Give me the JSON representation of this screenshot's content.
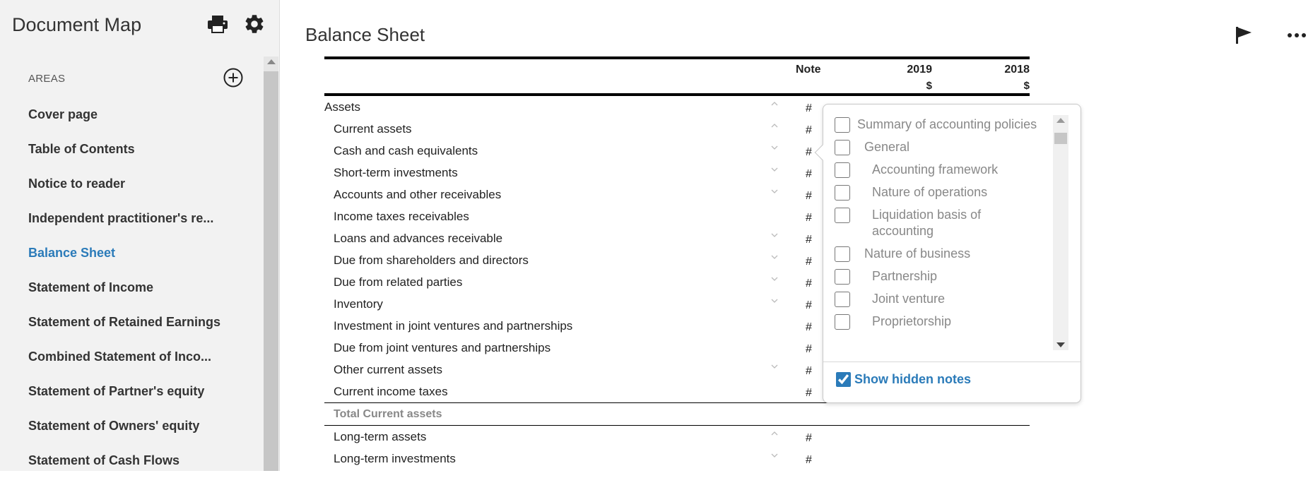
{
  "sidebar": {
    "title": "Document Map",
    "areas_label": "AREAS",
    "items": [
      {
        "label": "Cover page"
      },
      {
        "label": "Table of Contents"
      },
      {
        "label": "Notice to reader"
      },
      {
        "label": "Independent practitioner's re..."
      },
      {
        "label": "Balance Sheet"
      },
      {
        "label": "Statement of Income"
      },
      {
        "label": "Statement of Retained Earnings"
      },
      {
        "label": "Combined Statement of Inco..."
      },
      {
        "label": "Statement of Partner's equity"
      },
      {
        "label": "Statement of Owners' equity"
      },
      {
        "label": "Statement of Cash Flows"
      }
    ],
    "active_item": "Balance Sheet"
  },
  "main": {
    "title": "Balance Sheet",
    "table": {
      "note_header": "Note",
      "year1": "2019",
      "year2": "2018",
      "currency1": "$",
      "currency2": "$",
      "rows": [
        {
          "label": "Assets",
          "hash": "#",
          "chevron": "up"
        },
        {
          "label": "Current assets",
          "hash": "#",
          "chevron": "up"
        },
        {
          "label": "Cash and cash equivalents",
          "hash": "#",
          "chevron": "down"
        },
        {
          "label": "Short-term investments",
          "hash": "#",
          "chevron": "down"
        },
        {
          "label": "Accounts and other receivables",
          "hash": "#",
          "chevron": "down"
        },
        {
          "label": "Income taxes receivables",
          "hash": "#",
          "chevron": ""
        },
        {
          "label": "Loans and advances receivable",
          "hash": "#",
          "chevron": "down"
        },
        {
          "label": "Due from shareholders and directors",
          "hash": "#",
          "chevron": "down"
        },
        {
          "label": "Due from related parties",
          "hash": "#",
          "chevron": "down"
        },
        {
          "label": "Inventory",
          "hash": "#",
          "chevron": "down"
        },
        {
          "label": "Investment in joint ventures and partnerships",
          "hash": "#",
          "chevron": ""
        },
        {
          "label": "Due from joint ventures and partnerships",
          "hash": "#",
          "chevron": ""
        },
        {
          "label": "Other current assets",
          "hash": "#",
          "chevron": "down"
        },
        {
          "label": "Current income taxes",
          "hash": "#",
          "chevron": ""
        },
        {
          "label": "Total Current assets",
          "hash": "",
          "chevron": ""
        },
        {
          "label": "Long-term assets",
          "hash": "#",
          "chevron": "up"
        },
        {
          "label": "Long-term investments",
          "hash": "#",
          "chevron": "down"
        }
      ]
    }
  },
  "notes_popup": {
    "options": [
      {
        "label": "Summary of accounting policies",
        "checked": false
      },
      {
        "label": "General",
        "checked": false
      },
      {
        "label": "Accounting framework",
        "checked": false
      },
      {
        "label": "Nature of operations",
        "checked": false
      },
      {
        "label": "Liquidation basis of accounting",
        "checked": false
      },
      {
        "label": "Nature of business",
        "checked": false
      },
      {
        "label": "Partnership",
        "checked": false
      },
      {
        "label": "Joint venture",
        "checked": false
      },
      {
        "label": "Proprietorship",
        "checked": false
      }
    ],
    "show_hidden_label": "Show hidden notes",
    "show_hidden_checked": true
  },
  "colors": {
    "accent": "#2b7bb9",
    "sidebar_bg": "#f2f2f2"
  }
}
